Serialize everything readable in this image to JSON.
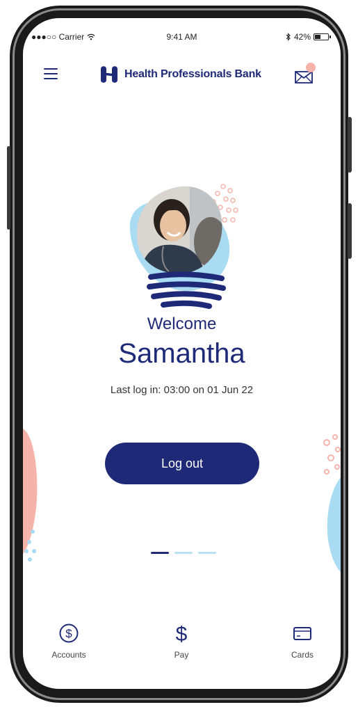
{
  "status_bar": {
    "carrier": "●●●○○ Carrier ",
    "time": "9:41 AM",
    "battery": "42%",
    "battery_level": 0.42
  },
  "header": {
    "brand_name": "Health Professionals Bank",
    "menu_icon": "hamburger-menu-icon",
    "mail_icon": "envelope-icon",
    "has_notification": true
  },
  "welcome": {
    "greeting": "Welcome",
    "user_name": "Samantha",
    "last_login": "Last log in: 03:00 on 01 Jun 22"
  },
  "actions": {
    "logout_label": "Log out"
  },
  "pager": {
    "page_count": 3,
    "active_page": 1
  },
  "tabbar": {
    "items": [
      {
        "label": "Accounts",
        "icon": "dollar-circle-icon"
      },
      {
        "label": "Pay",
        "icon": "dollar-sign-icon"
      },
      {
        "label": "Cards",
        "icon": "credit-card-icon"
      }
    ]
  },
  "colors": {
    "brand_navy": "#1e2a78",
    "accent_blue": "#a9dbf2",
    "accent_pink": "#f6b3aa"
  }
}
